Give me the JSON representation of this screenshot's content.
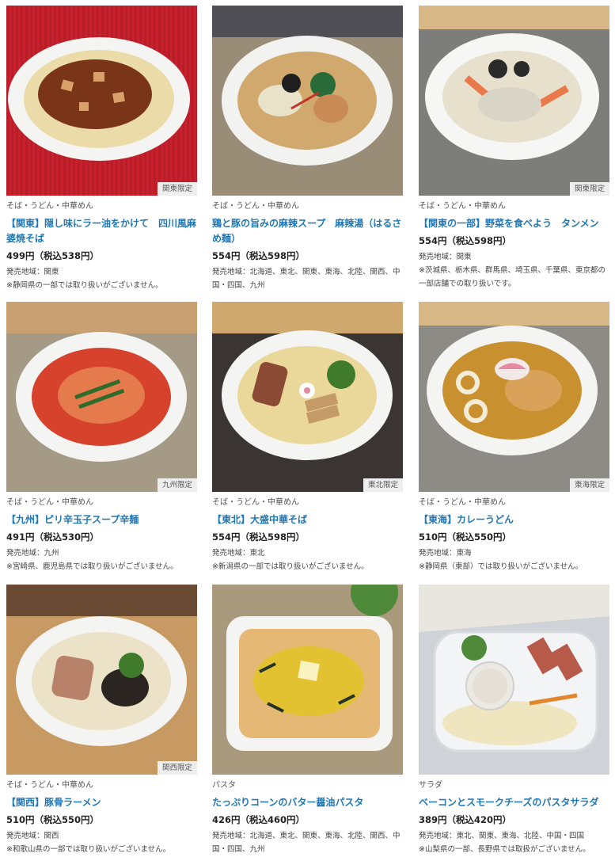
{
  "products": [
    {
      "category": "そば・うどん・中華めん",
      "title": "【関東】隠し味にラー油をかけて　四川風麻婆焼そば",
      "price": "499円（税込538円）",
      "area": "発売地域：関東",
      "note": "※静岡県の一部では取り扱いがございません。",
      "badge": "関東限定",
      "icon": "mapo-noodle-image"
    },
    {
      "category": "そば・うどん・中華めん",
      "title": "鶏と豚の旨みの麻辣スープ　麻辣湯（はるさめ麺）",
      "price": "554円（税込598円）",
      "area": "発売地域：北海道、東北、関東、東海、北陸、関西、中国・四国、九州",
      "note": "",
      "badge": "",
      "icon": "malatang-image"
    },
    {
      "category": "そば・うどん・中華めん",
      "title": "【関東の一部】野菜を食べよう　タンメン",
      "price": "554円（税込598円）",
      "area": "発売地域：関東",
      "note": "※茨城県、栃木県、群馬県、埼玉県、千葉県、東京都の一部店舗での取り扱いです。",
      "badge": "関東限定",
      "icon": "tanmen-image"
    },
    {
      "category": "そば・うどん・中華めん",
      "title": "【九州】ピリ辛玉子スープ辛麺",
      "price": "491円（税込530円）",
      "area": "発売地域：九州",
      "note": "※宮崎県、鹿児島県では取り扱いがございません。",
      "badge": "九州限定",
      "icon": "karamen-image"
    },
    {
      "category": "そば・うどん・中華めん",
      "title": "【東北】大盛中華そば",
      "price": "554円（税込598円）",
      "area": "発売地域：東北",
      "note": "※新潟県の一部では取り扱いがございません。",
      "badge": "東北限定",
      "icon": "chuka-soba-image"
    },
    {
      "category": "そば・うどん・中華めん",
      "title": "【東海】カレーうどん",
      "price": "510円（税込550円）",
      "area": "発売地域：東海",
      "note": "※静岡県（東部）では取り扱いがございません。",
      "badge": "東海限定",
      "icon": "curry-udon-image"
    },
    {
      "category": "そば・うどん・中華めん",
      "title": "【関西】豚骨ラーメン",
      "price": "510円（税込550円）",
      "area": "発売地域：関西",
      "note": "※和歌山県の一部では取り扱いがございません。",
      "badge": "関西限定",
      "icon": "tonkotsu-ramen-image"
    },
    {
      "category": "パスタ",
      "title": "たっぷりコーンのバター醤油パスタ",
      "price": "426円（税込460円）",
      "area": "発売地域：北海道、東北、関東、東海、北陸、関西、中国・四国、九州",
      "note": "",
      "badge": "",
      "icon": "corn-pasta-image"
    },
    {
      "category": "サラダ",
      "title": "ベーコンとスモークチーズのパスタサラダ",
      "price": "389円（税込420円）",
      "area": "発売地域：東北、関東、東海、北陸、中国・四国",
      "note": "※山梨県の一部、長野県では取扱がございません。",
      "badge": "",
      "icon": "pasta-salad-image"
    }
  ]
}
